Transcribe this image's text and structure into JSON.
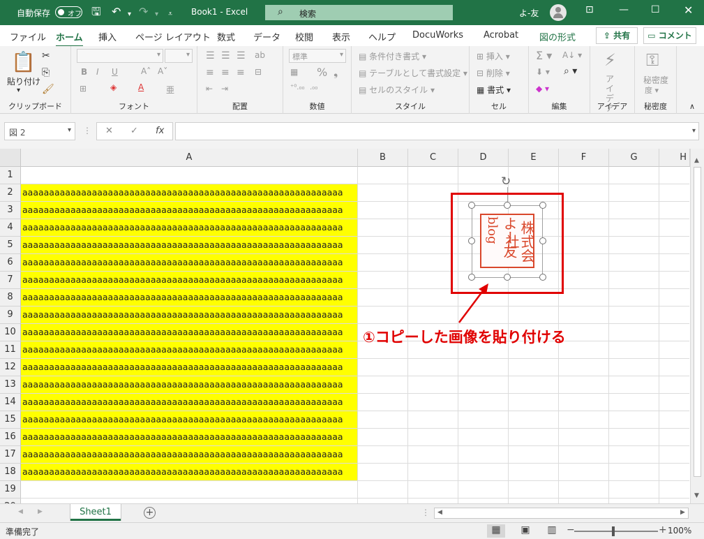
{
  "titlebar": {
    "autosave_label": "自動保存",
    "autosave_toggle": "オフ",
    "title": "Book1  -  Excel",
    "search_placeholder": "検索",
    "username": "よ-友"
  },
  "tabs": [
    "ファイル",
    "ホーム",
    "挿入",
    "ページ レイアウト",
    "数式",
    "データ",
    "校閲",
    "表示",
    "ヘルプ",
    "DocuWorks",
    "Acrobat",
    "図の形式"
  ],
  "active_tab": "ホーム",
  "share_label": "共有",
  "comment_label": "コメント",
  "ribbon": {
    "clipboard": {
      "paste": "貼り付け",
      "label": "クリップボード"
    },
    "font": {
      "label": "フォント"
    },
    "alignment": {
      "label": "配置"
    },
    "number": {
      "format": "標準",
      "label": "数値"
    },
    "styles": {
      "cond": "条件付き書式",
      "table": "テーブルとして書式設定",
      "cell": "セルのスタイル",
      "label": "スタイル"
    },
    "cells": {
      "insert": "挿入",
      "delete": "削除",
      "format": "書式",
      "label": "セル"
    },
    "editing": {
      "label": "編集"
    },
    "ideas": {
      "name": "アイデア",
      "label": "アイデア"
    },
    "sensitivity": {
      "name": "秘密度",
      "label": "秘密度"
    }
  },
  "formula_bar": {
    "name_box": "図 2",
    "formula": ""
  },
  "columns": [
    "A",
    "B",
    "C",
    "D",
    "E",
    "F",
    "G",
    "H"
  ],
  "rows": [
    "1",
    "2",
    "3",
    "4",
    "5",
    "6",
    "7",
    "8",
    "9",
    "10",
    "11",
    "12",
    "13",
    "14",
    "15",
    "16",
    "17",
    "18",
    "19",
    "20"
  ],
  "cell_text": "aaaaaaaaaaaaaaaaaaaaaaaaaaaaaaaaaaaaaaaaaaaaaaaaaaaaaaaaaaaa",
  "filled_rows": [
    "2",
    "3",
    "4",
    "5",
    "6",
    "7",
    "8",
    "9",
    "10",
    "11",
    "12",
    "13",
    "14",
    "15",
    "16",
    "17",
    "18"
  ],
  "fill_color": "#FFFF00",
  "seal": {
    "col1": "株式会社",
    "col2": "よー友",
    "col3": "blog"
  },
  "annotation": "①コピーした画像を貼り付ける",
  "sheet_tab": "Sheet1",
  "status": "準備完了",
  "zoom": "100%",
  "colors": {
    "brand": "#217346",
    "annotation": "#E00000",
    "seal": "#D9472B"
  }
}
